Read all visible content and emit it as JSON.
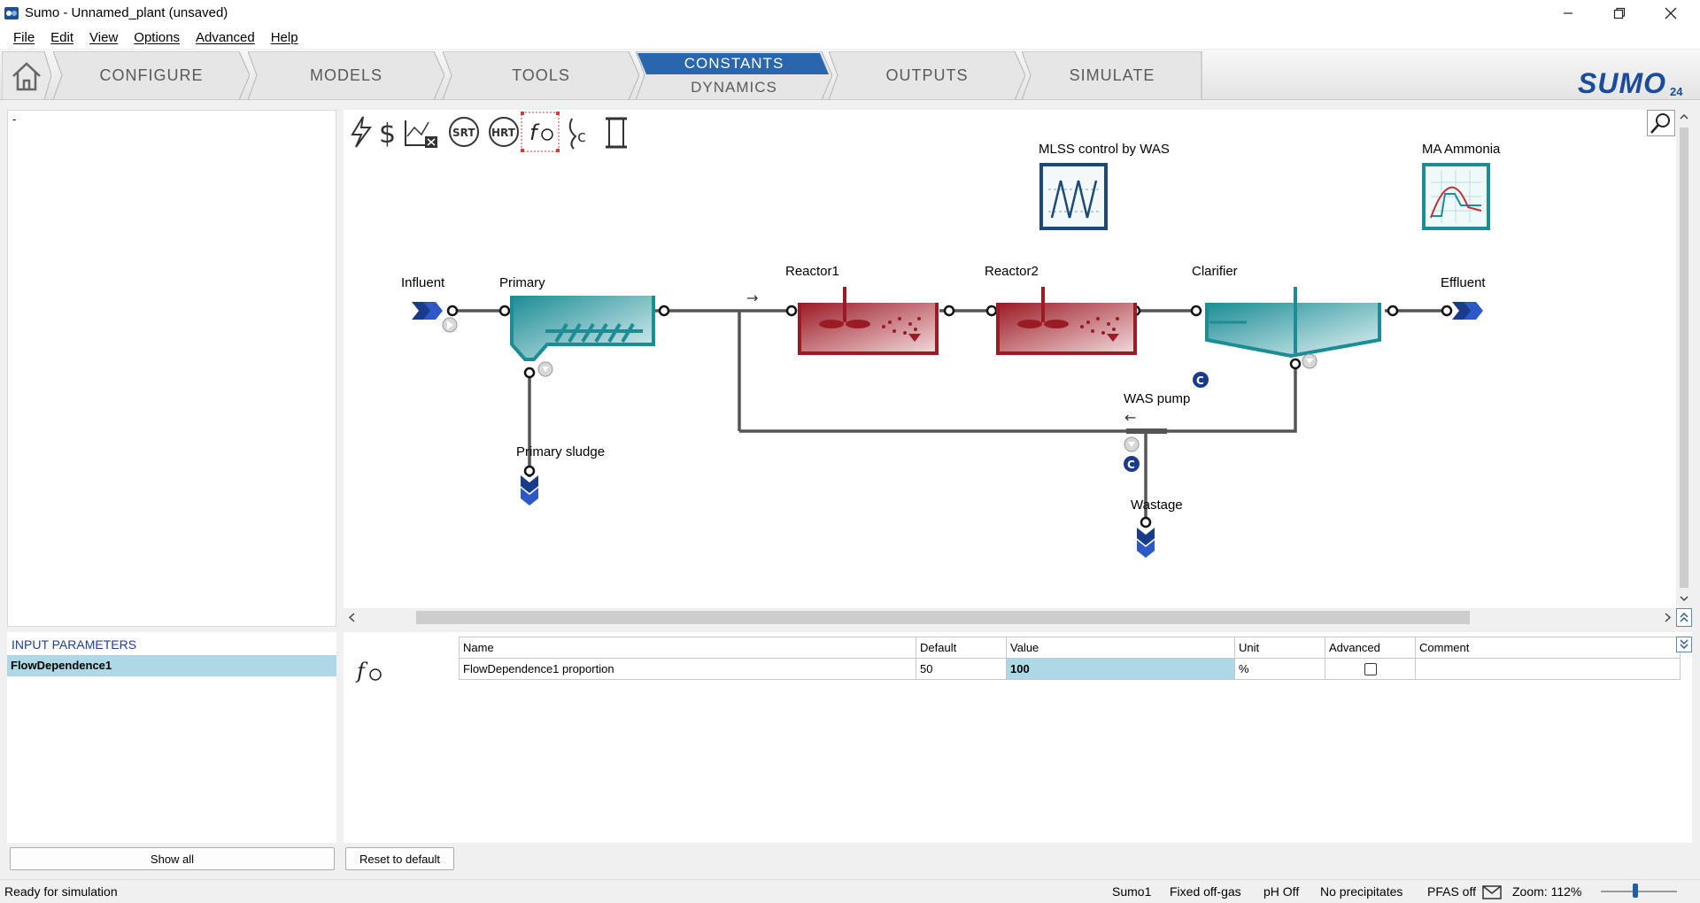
{
  "window": {
    "title": "Sumo - Unnamed_plant (unsaved)"
  },
  "menu": [
    "File",
    "Edit",
    "View",
    "Options",
    "Advanced",
    "Help"
  ],
  "nav": {
    "tabs": [
      "CONFIGURE",
      "MODELS",
      "TOOLS",
      "CONSTANTS",
      "DYNAMICS",
      "OUTPUTS",
      "SIMULATE"
    ],
    "active_top": "CONSTANTS",
    "active_bottom": "DYNAMICS",
    "logo": "SUMO",
    "logo_version": "24"
  },
  "left_panel": {
    "placeholder": "-"
  },
  "toolbar_icons": [
    "power-icon",
    "cost-icon",
    "chart-x-icon",
    "srt-icon",
    "hrt-icon",
    "flow-dependence-icon",
    "calc-c-icon",
    "scroll-icon"
  ],
  "toolbar_labels": {
    "srt": "SRT",
    "hrt": "HRT",
    "c": "c"
  },
  "process": {
    "labels": {
      "influent": "Influent",
      "primary": "Primary",
      "reactor1": "Reactor1",
      "reactor2": "Reactor2",
      "clarifier": "Clarifier",
      "effluent": "Effluent",
      "primary_sludge": "Primary sludge",
      "was_pump": "WAS pump",
      "wastage": "Wastage",
      "mlss_control": "MLSS control by WAS",
      "ma_ammonia": "MA Ammonia",
      "c_badge": "C"
    }
  },
  "input_params": {
    "header": "INPUT PARAMETERS",
    "selected": "FlowDependence1",
    "columns": [
      "Name",
      "Default",
      "Value",
      "Unit",
      "Advanced",
      "Comment"
    ],
    "rows": [
      {
        "name": "FlowDependence1 proportion",
        "default": "50",
        "value": "100",
        "unit": "%",
        "advanced": false,
        "comment": ""
      }
    ]
  },
  "buttons": {
    "show_all": "Show all",
    "reset_default": "Reset to default"
  },
  "status": {
    "left": "Ready for simulation",
    "items": [
      "Sumo1",
      "Fixed off-gas",
      "pH Off",
      "No precipitates",
      "PFAS off"
    ],
    "zoom": "Zoom: 112%"
  },
  "colors": {
    "accent": "#1f5fa3",
    "tank_teal": "#1c8c95",
    "reactor_red": "#9b1b25",
    "arrow_blue": "#1a3a8a"
  }
}
